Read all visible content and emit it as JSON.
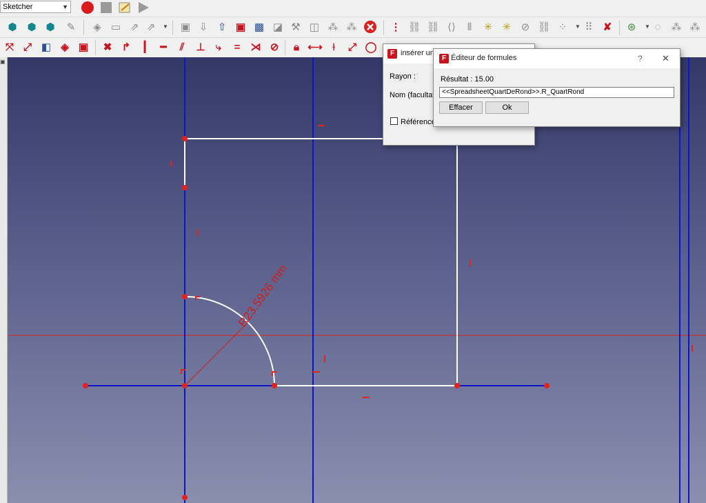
{
  "toolbar": {
    "workbench": "Sketcher"
  },
  "sketch": {
    "radius_label": "R23.5926 mm"
  },
  "arc_dialog": {
    "title": "insérer un",
    "radius_label": "Rayon :",
    "name_label": "Nom (facultatif)",
    "reference_label": "Référence"
  },
  "formula_editor": {
    "title": "Éditeur de formules",
    "help": "?",
    "close": "✕",
    "result": "Résultat : 15.00",
    "expression": "<<SpreadsheetQuartDeRond>>.R_QuartRond",
    "clear_label": "Effacer",
    "ok_label": "Ok"
  },
  "colors": {
    "constraint_red": "#e0231e",
    "construction_blue": "#0a16c8",
    "geometry_white": "#ffffff",
    "viewport_top": "#333867",
    "viewport_bottom": "#8a8eae"
  }
}
